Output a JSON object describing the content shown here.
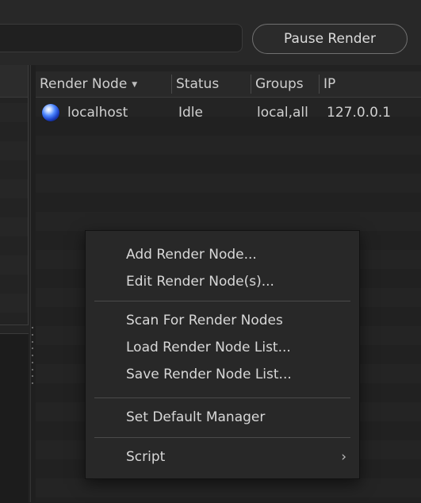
{
  "toolbar": {
    "pause_label": "Pause Render"
  },
  "table": {
    "columns": [
      {
        "label": "Render Node",
        "sorted": "descending"
      },
      {
        "label": "Status"
      },
      {
        "label": "Groups"
      },
      {
        "label": "IP"
      }
    ],
    "rows": [
      {
        "icon": "globe-icon",
        "name": "localhost",
        "status": "Idle",
        "groups": "local,all",
        "ip": "127.0.0.1"
      }
    ]
  },
  "context_menu": {
    "items": [
      {
        "label": "Add Render Node..."
      },
      {
        "label": "Edit Render Node(s)..."
      },
      {
        "label": "Scan For Render Nodes"
      },
      {
        "label": "Load Render Node List..."
      },
      {
        "label": "Save Render Node List..."
      },
      {
        "label": "Set Default Manager"
      },
      {
        "label": "Script",
        "submenu_arrow": "›"
      }
    ]
  },
  "colors": {
    "background": "#1f1f1f",
    "menu_background": "#282828",
    "text": "#d4d4d4",
    "node_icon": "#3b6cf0"
  }
}
